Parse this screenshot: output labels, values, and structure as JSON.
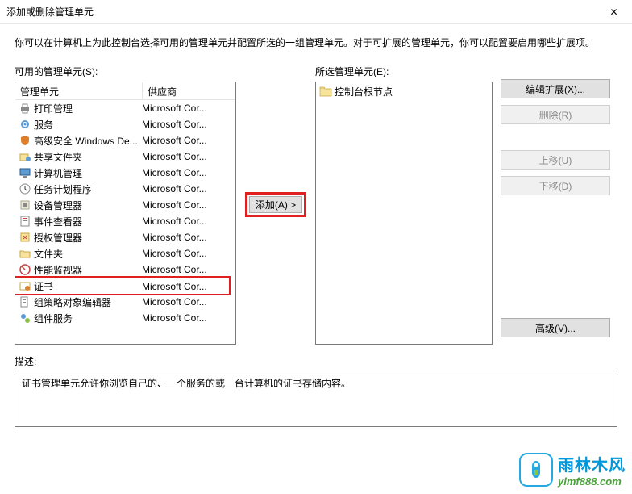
{
  "window": {
    "title": "添加或删除管理单元",
    "close_icon": "✕"
  },
  "intro": "你可以在计算机上为此控制台选择可用的管理单元并配置所选的一组管理单元。对于可扩展的管理单元，你可以配置要启用哪些扩展项。",
  "left": {
    "label": "可用的管理单元(S):",
    "header_name": "管理单元",
    "header_vendor": "供应商",
    "items": [
      {
        "name": "打印管理",
        "vendor": "Microsoft Cor...",
        "icon": "printer"
      },
      {
        "name": "服务",
        "vendor": "Microsoft Cor...",
        "icon": "gear"
      },
      {
        "name": "高级安全 Windows De...",
        "vendor": "Microsoft Cor...",
        "icon": "shield"
      },
      {
        "name": "共享文件夹",
        "vendor": "Microsoft Cor...",
        "icon": "share"
      },
      {
        "name": "计算机管理",
        "vendor": "Microsoft Cor...",
        "icon": "computer"
      },
      {
        "name": "任务计划程序",
        "vendor": "Microsoft Cor...",
        "icon": "clock"
      },
      {
        "name": "设备管理器",
        "vendor": "Microsoft Cor...",
        "icon": "device"
      },
      {
        "name": "事件查看器",
        "vendor": "Microsoft Cor...",
        "icon": "event"
      },
      {
        "name": "授权管理器",
        "vendor": "Microsoft Cor...",
        "icon": "auth"
      },
      {
        "name": "文件夹",
        "vendor": "Microsoft Cor...",
        "icon": "folder"
      },
      {
        "name": "性能监视器",
        "vendor": "Microsoft Cor...",
        "icon": "perf"
      },
      {
        "name": "证书",
        "vendor": "Microsoft Cor...",
        "icon": "cert",
        "highlighted": true
      },
      {
        "name": "组策略对象编辑器",
        "vendor": "Microsoft Cor...",
        "icon": "policy"
      },
      {
        "name": "组件服务",
        "vendor": "Microsoft Cor...",
        "icon": "component"
      }
    ]
  },
  "mid": {
    "add_label": "添加(A) >"
  },
  "right": {
    "label": "所选管理单元(E):",
    "root_node": "控制台根节点"
  },
  "buttons": {
    "edit_ext": "编辑扩展(X)...",
    "remove": "删除(R)",
    "move_up": "上移(U)",
    "move_down": "下移(D)",
    "advanced": "高级(V)..."
  },
  "description": {
    "label": "描述:",
    "text": "证书管理单元允许你浏览自己的、一个服务的或一台计算机的证书存储内容。"
  },
  "watermark": {
    "cn": "雨林木风",
    "url": "ylmf888.com"
  }
}
